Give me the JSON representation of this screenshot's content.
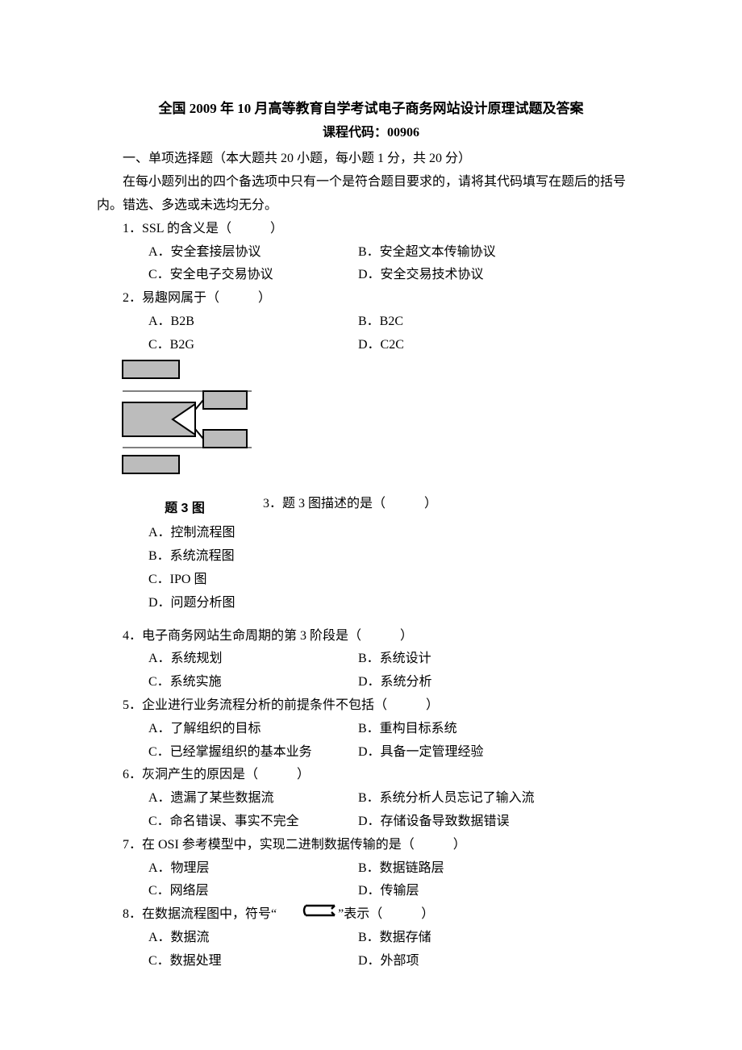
{
  "header": {
    "title": "全国 2009 年 10 月高等教育自学考试电子商务网站设计原理试题及答案",
    "subtitle": "课程代码：00906"
  },
  "section1": {
    "heading": "一、单项选择题（本大题共 20 小题，每小题 1 分，共 20 分）",
    "instruction": "在每小题列出的四个备选项中只有一个是符合题目要求的，请将其代码填写在题后的括号内。错选、多选或未选均无分。"
  },
  "q1": {
    "stem": "1．SSL 的含义是（　　　）",
    "a": "A．安全套接层协议",
    "b": "B．安全超文本传输协议",
    "c": "C．安全电子交易协议",
    "d": "D．安全交易技术协议"
  },
  "q2": {
    "stem": "2．易趣网属于（　　　）",
    "a": "A．B2B",
    "b": "B．B2C",
    "c": "C．B2G",
    "d": "D．C2C"
  },
  "q3": {
    "fig_caption": "题 3 图",
    "stem_inline": "3．题 3 图描述的是（　　　）",
    "a": "A．控制流程图",
    "b": "B．系统流程图",
    "c": "C．IPO 图",
    "d": "D．问题分析图"
  },
  "q4": {
    "stem": "4．电子商务网站生命周期的第 3 阶段是（　　　）",
    "a": "A．系统规划",
    "b": "B．系统设计",
    "c": "C．系统实施",
    "d": "D．系统分析"
  },
  "q5": {
    "stem": "5．企业进行业务流程分析的前提条件不包括（　　　）",
    "a": "A．了解组织的目标",
    "b": "B．重构目标系统",
    "c": "C．已经掌握组织的基本业务",
    "d": "D．具备一定管理经验"
  },
  "q6": {
    "stem": "6．灰洞产生的原因是（　　　）",
    "a": "A．遗漏了某些数据流",
    "b": "B．系统分析人员忘记了输入流",
    "c": "C．命名错误、事实不完全",
    "d": "D．存储设备导致数据错误"
  },
  "q7": {
    "stem": "7．在 OSI 参考模型中，实现二进制数据传输的是（　　　）",
    "a": "A．物理层",
    "b": "B．数据链路层",
    "c": "C．网络层",
    "d": "D．传输层"
  },
  "q8": {
    "stem_pre": "8．在数据流程图中，符号“",
    "stem_post": "”表示（　　　）",
    "a": "A．数据流",
    "b": "B．数据存储",
    "c": "C．数据处理",
    "d": "D．外部项"
  }
}
